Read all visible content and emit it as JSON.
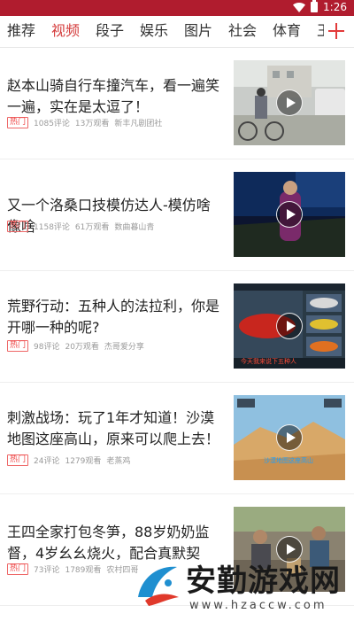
{
  "status_bar": {
    "time": "1:26"
  },
  "tabs": [
    {
      "label": "推荐",
      "active": false
    },
    {
      "label": "视频",
      "active": true
    },
    {
      "label": "段子",
      "active": false
    },
    {
      "label": "娱乐",
      "active": false
    },
    {
      "label": "图片",
      "active": false
    },
    {
      "label": "社会",
      "active": false
    },
    {
      "label": "体育",
      "active": false
    },
    {
      "label": "王",
      "active": false
    }
  ],
  "colors": {
    "status_bar": "#b01c2e",
    "accent": "#d43b3b",
    "badge": "#e44444"
  },
  "icons": {
    "add_tab": "plus-icon",
    "play": "play-icon"
  },
  "feed": [
    {
      "title": "赵本山骑自行车撞汽车，看一遍笑一遍，实在是太逗了！",
      "badge": "热门",
      "comments": "1085评论",
      "views": "13万观看",
      "source": "新丰凡剧团社"
    },
    {
      "title": "又一个洛桑口技模仿达人-模仿啥像啥",
      "badge": "热门",
      "comments": "1158评论",
      "views": "61万观看",
      "source": "数曲暮山青"
    },
    {
      "title": "荒野行动：五种人的法拉利，你是开哪一种的呢?",
      "badge": "热门",
      "comments": "98评论",
      "views": "20万观看",
      "source": "杰哥爱分享"
    },
    {
      "title": "刺激战场：玩了1年才知道！沙漠地图这座高山，原来可以爬上去！",
      "badge": "热门",
      "comments": "24评论",
      "views": "1279观看",
      "source": "老蒸鸡"
    },
    {
      "title": "王四全家打包冬笋，88岁奶奶监督，4岁幺幺烧火，配合真默契",
      "badge": "热门",
      "comments": "73评论",
      "views": "1789观看",
      "source": "农村四哥"
    }
  ],
  "thumb_captions": {
    "item3": "今天我来说下五种人",
    "item4": "沙漠地图这座高山"
  },
  "watermark": {
    "brand": "安勤游戏网",
    "url": "www.hzaccw.com"
  }
}
